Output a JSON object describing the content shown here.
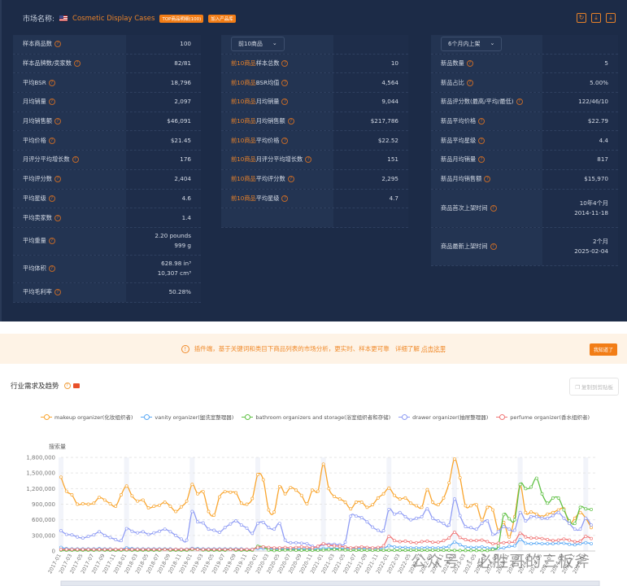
{
  "header": {
    "label": "市场名称:",
    "market": "Cosmetic Display Cases",
    "tag1": "TOP商品明细(100)",
    "tag2": "加入产品库",
    "icons": [
      "refresh-icon",
      "download-icon",
      "download-icon"
    ]
  },
  "table1": [
    [
      "样本商品数",
      "100"
    ],
    [
      "样本品牌数/卖家数",
      "82/81"
    ],
    [
      "平均BSR",
      "18,796"
    ],
    [
      "月均销量",
      "2,097"
    ],
    [
      "月均销售额",
      "$46,091"
    ],
    [
      "平均价格",
      "$21.45"
    ],
    [
      "月评分平均增长数",
      "176"
    ],
    [
      "平均评分数",
      "2,404"
    ],
    [
      "平均星级",
      "4.6"
    ],
    [
      "平均卖家数",
      "1.4"
    ],
    [
      "平均重量",
      "2.20 pounds",
      "999 g"
    ],
    [
      "平均体积",
      "628.98 in³",
      "10,307 cm³"
    ],
    [
      "平均毛利率",
      "50.28%"
    ]
  ],
  "table2": {
    "select": "前10商品",
    "prefix": "前10商品",
    "rows": [
      [
        "样本总数",
        "10"
      ],
      [
        "BSR均值",
        "4,564"
      ],
      [
        "月均销量",
        "9,044"
      ],
      [
        "月均销售额",
        "$217,786"
      ],
      [
        "平均价格",
        "$22.52"
      ],
      [
        "月评分平均增长数",
        "151"
      ],
      [
        "平均评分数",
        "2,295"
      ],
      [
        "平均星级",
        "4.7"
      ]
    ]
  },
  "table3": {
    "select": "6个月内上架",
    "rows": [
      [
        "新品数量",
        "5"
      ],
      [
        "新品占比",
        "5.00%"
      ],
      [
        "新品评分数(最高/平均/最低)",
        "122/46/10"
      ],
      [
        "新品平均价格",
        "$22.79"
      ],
      [
        "新品平均星级",
        "4.4"
      ],
      [
        "新品月均销量",
        "817"
      ],
      [
        "新品月均销售额",
        "$15,970"
      ],
      [
        "商品首次上架时间",
        "10年4个月",
        "2014-11-18"
      ],
      [
        "商品最新上架时间",
        "2个月",
        "2025-02-04"
      ]
    ]
  },
  "banner": {
    "text": "插件端，基于关键词和类目下商品列表的市场分析，更实时、样本更可靠   详细了解 ",
    "link": "点击这里",
    "button": "我知道了"
  },
  "section": {
    "title": "行业需求及趋势",
    "copy": "复制到剪贴板"
  },
  "watermark": "公众号 · 必胜哥的三板斧",
  "chart_data": {
    "type": "line",
    "ylabel": "搜索量",
    "ylim": [
      0,
      1800000
    ],
    "yticks": [
      0,
      300000,
      600000,
      900000,
      1200000,
      1500000,
      1800000
    ],
    "grid": "horizontal dashed",
    "legend_position": "top",
    "x": [
      "2017-01",
      "2017-02",
      "2017-03",
      "2017-04",
      "2017-05",
      "2017-06",
      "2017-07",
      "2017-08",
      "2017-09",
      "2017-10",
      "2017-11",
      "2017-12",
      "2018-01",
      "2018-02",
      "2018-03",
      "2018-04",
      "2018-05",
      "2018-06",
      "2018-07",
      "2018-08",
      "2018-09",
      "2018-10",
      "2018-11",
      "2018-12",
      "2019-01",
      "2019-02",
      "2019-03",
      "2019-04",
      "2019-05",
      "2019-06",
      "2019-07",
      "2019-08",
      "2019-09",
      "2019-10",
      "2019-11",
      "2019-12",
      "2020-01",
      "2020-02",
      "2020-03",
      "2020-04",
      "2020-05",
      "2020-06",
      "2020-07",
      "2020-08",
      "2020-09",
      "2020-10",
      "2020-11",
      "2020-12",
      "2021-01",
      "2021-02",
      "2021-03",
      "2021-04",
      "2021-05",
      "2021-06",
      "2021-07",
      "2021-08",
      "2021-09",
      "2021-10",
      "2021-11",
      "2021-12",
      "2022-01",
      "2022-02",
      "2022-03",
      "2022-04",
      "2022-05",
      "2022-06",
      "2022-07",
      "2022-08",
      "2022-09",
      "2022-10",
      "2022-11",
      "2022-12",
      "2023-01",
      "2023-02",
      "2023-03",
      "2023-04",
      "2023-05",
      "2023-06",
      "2023-07",
      "2023-08",
      "2023-09",
      "2023-10",
      "2023-11",
      "2023-12",
      "2024-01",
      "2024-02",
      "2024-03",
      "2024-04",
      "2024-05",
      "2024-06",
      "2024-07",
      "2024-08",
      "2024-09",
      "2024-10",
      "2024-11",
      "2024-12",
      "2025-01",
      "2025-02"
    ],
    "series": [
      {
        "name": "makeup organizer(化妆组织者)",
        "color": "#f9a52e",
        "values": [
          1420000,
          1150000,
          1080000,
          900000,
          910000,
          900000,
          920000,
          1030000,
          980000,
          910000,
          860000,
          1080000,
          1250000,
          1060000,
          960000,
          980000,
          830000,
          860000,
          880000,
          940000,
          860000,
          760000,
          850000,
          960000,
          1280000,
          1100000,
          1140000,
          760000,
          690000,
          1040000,
          1140000,
          1130000,
          1120000,
          920000,
          900000,
          1010000,
          1470000,
          1370000,
          790000,
          750000,
          1240000,
          1100000,
          1220000,
          1170000,
          1070000,
          910000,
          1170000,
          1150000,
          1670000,
          1200000,
          1050000,
          1000000,
          940000,
          810000,
          940000,
          940000,
          840000,
          890000,
          1020000,
          1100000,
          1210000,
          1070000,
          1000000,
          1020000,
          920000,
          870000,
          840000,
          1180000,
          940000,
          890000,
          1020000,
          1310000,
          1770000,
          1410000,
          870000,
          870000,
          890000,
          600000,
          840000,
          790000,
          400000,
          550000,
          270000,
          660000,
          1260000,
          740000,
          750000,
          710000,
          660000,
          710000,
          740000,
          790000,
          810000,
          530000,
          630000,
          740000,
          630000,
          450000
        ]
      },
      {
        "name": "vanity organizer(盥洗室整理器)",
        "color": "#5aa9f5",
        "values": [
          70000,
          45000,
          40000,
          40000,
          40000,
          40000,
          40000,
          45000,
          40000,
          40000,
          35000,
          35000,
          60000,
          45000,
          40000,
          40000,
          40000,
          40000,
          40000,
          40000,
          40000,
          35000,
          35000,
          35000,
          50000,
          45000,
          40000,
          40000,
          40000,
          40000,
          40000,
          40000,
          40000,
          40000,
          35000,
          35000,
          50000,
          50000,
          45000,
          40000,
          40000,
          40000,
          40000,
          40000,
          40000,
          40000,
          40000,
          40000,
          50000,
          50000,
          50000,
          50000,
          50000,
          50000,
          50000,
          50000,
          50000,
          50000,
          50000,
          50000,
          100000,
          80000,
          70000,
          70000,
          60000,
          60000,
          60000,
          70000,
          60000,
          60000,
          70000,
          90000,
          170000,
          120000,
          80000,
          70000,
          70000,
          80000,
          60000,
          50000,
          50000,
          60000,
          90000,
          100000,
          220000,
          150000,
          140000,
          150000,
          140000,
          140000,
          140000,
          150000,
          150000,
          130000,
          120000,
          140000,
          160000,
          140000
        ]
      },
      {
        "name": "bathroom organizers and storage(浴室组织者和存储)",
        "color": "#5fc144",
        "values": [
          15000,
          15000,
          15000,
          15000,
          15000,
          15000,
          15000,
          20000,
          15000,
          15000,
          15000,
          15000,
          20000,
          15000,
          15000,
          15000,
          15000,
          15000,
          15000,
          30000,
          15000,
          15000,
          15000,
          15000,
          30000,
          30000,
          20000,
          15000,
          15000,
          15000,
          15000,
          30000,
          15000,
          15000,
          15000,
          15000,
          90000,
          80000,
          20000,
          10000,
          15000,
          20000,
          20000,
          15000,
          15000,
          15000,
          15000,
          15000,
          20000,
          25000,
          30000,
          25000,
          20000,
          15000,
          15000,
          15000,
          15000,
          15000,
          15000,
          15000,
          15000,
          15000,
          15000,
          15000,
          15000,
          15000,
          15000,
          15000,
          15000,
          15000,
          15000,
          15000,
          10000,
          10000,
          10000,
          10000,
          10000,
          10000,
          10000,
          30000,
          100000,
          700000,
          620000,
          600000,
          1280000,
          1200000,
          1230000,
          1400000,
          1100000,
          920000,
          1020000,
          1020000,
          790000,
          580000,
          530000,
          840000,
          810000,
          800000
        ]
      },
      {
        "name": "drawer organizer(抽屉整理器)",
        "color": "#8f9cf4",
        "values": [
          390000,
          320000,
          310000,
          270000,
          250000,
          280000,
          310000,
          370000,
          300000,
          260000,
          220000,
          200000,
          430000,
          380000,
          350000,
          370000,
          320000,
          350000,
          380000,
          420000,
          370000,
          300000,
          230000,
          210000,
          760000,
          560000,
          540000,
          420000,
          400000,
          360000,
          450000,
          520000,
          580000,
          500000,
          440000,
          340000,
          530000,
          550000,
          450000,
          420000,
          530000,
          210000,
          160000,
          160000,
          150000,
          140000,
          90000,
          80000,
          130000,
          130000,
          130000,
          120000,
          170000,
          670000,
          670000,
          640000,
          560000,
          460000,
          400000,
          390000,
          800000,
          710000,
          740000,
          660000,
          600000,
          630000,
          660000,
          810000,
          630000,
          580000,
          530000,
          500000,
          1000000,
          680000,
          470000,
          450000,
          420000,
          530000,
          580000,
          320000,
          370000,
          470000,
          420000,
          400000,
          740000,
          580000,
          660000,
          660000,
          630000,
          630000,
          680000,
          740000,
          630000,
          530000,
          420000,
          420000,
          630000,
          500000
        ]
      },
      {
        "name": "perfume organizer(香水组织者)",
        "color": "#f07575",
        "values": [
          30000,
          30000,
          30000,
          30000,
          30000,
          30000,
          30000,
          30000,
          30000,
          30000,
          30000,
          30000,
          30000,
          30000,
          30000,
          30000,
          30000,
          30000,
          30000,
          30000,
          30000,
          30000,
          30000,
          30000,
          40000,
          30000,
          30000,
          30000,
          30000,
          30000,
          30000,
          30000,
          30000,
          30000,
          30000,
          30000,
          70000,
          80000,
          70000,
          60000,
          60000,
          70000,
          60000,
          70000,
          80000,
          70000,
          60000,
          90000,
          140000,
          110000,
          100000,
          90000,
          80000,
          60000,
          70000,
          80000,
          70000,
          60000,
          70000,
          100000,
          280000,
          200000,
          180000,
          190000,
          170000,
          160000,
          180000,
          190000,
          170000,
          170000,
          200000,
          250000,
          360000,
          260000,
          220000,
          200000,
          200000,
          210000,
          180000,
          140000,
          150000,
          160000,
          170000,
          180000,
          340000,
          270000,
          250000,
          250000,
          240000,
          220000,
          200000,
          210000,
          230000,
          210000,
          180000,
          190000,
          280000,
          240000
        ]
      }
    ]
  }
}
